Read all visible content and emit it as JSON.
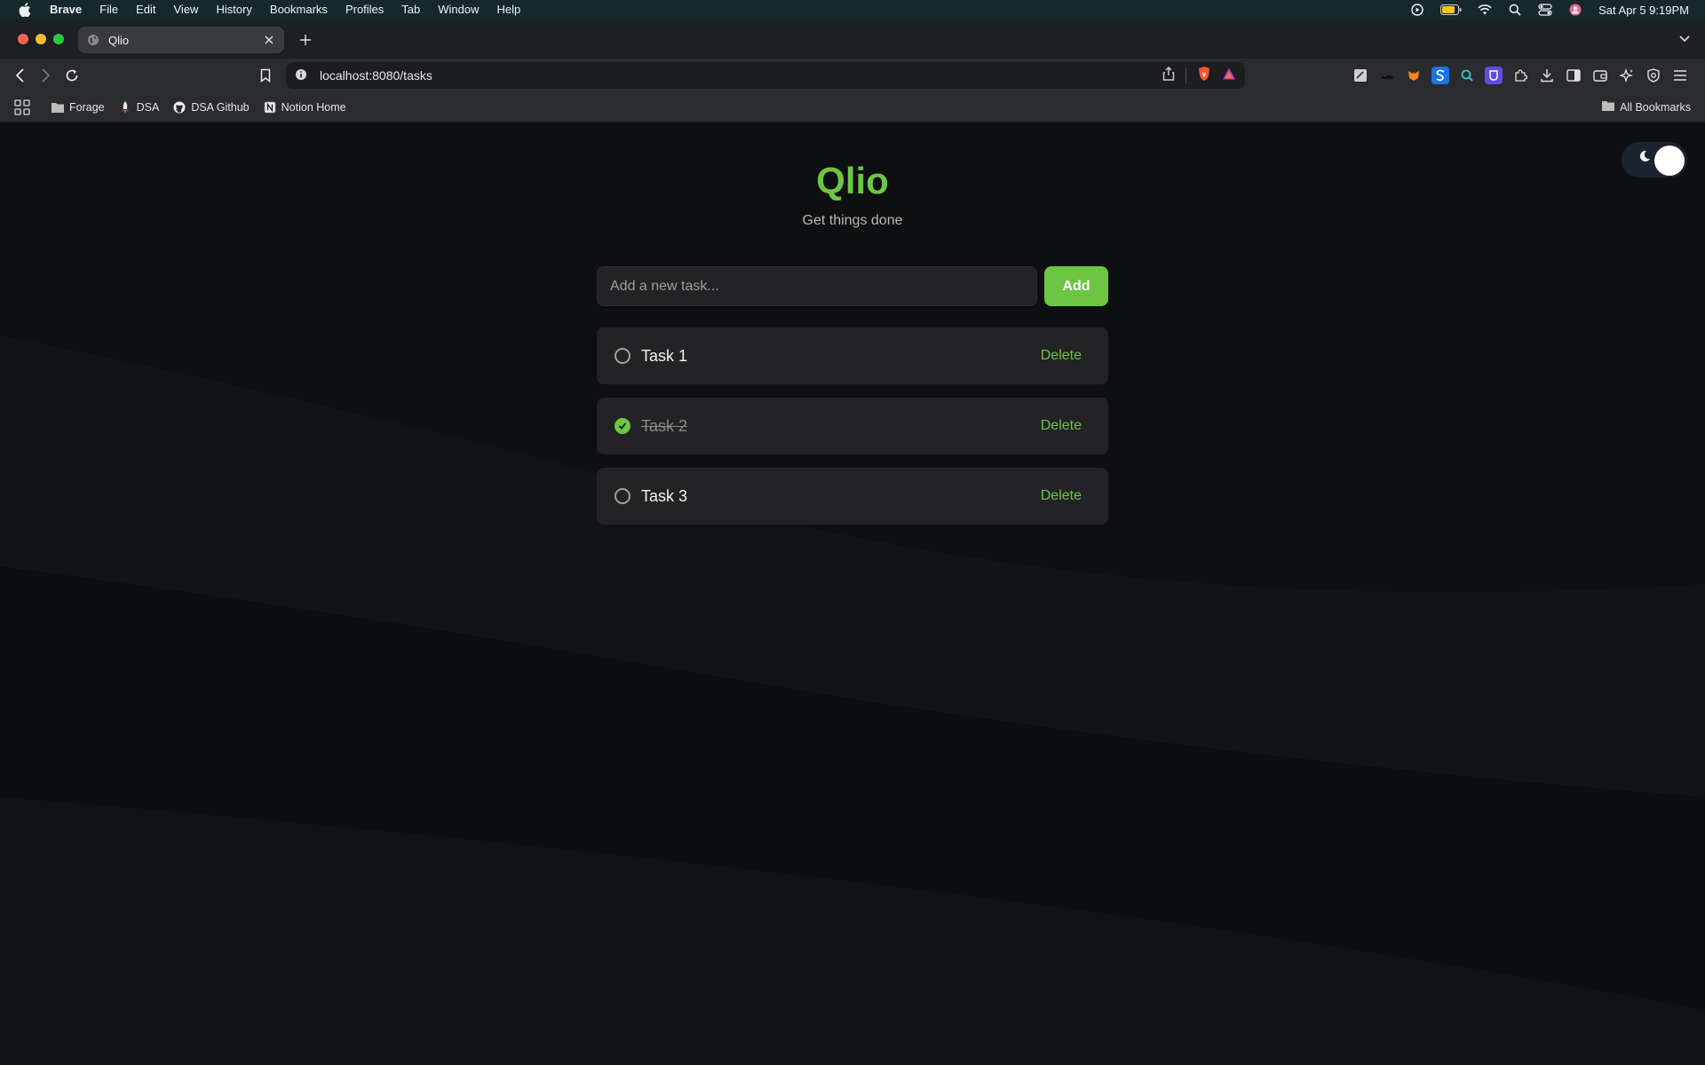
{
  "menubar": {
    "app": "Brave",
    "items": [
      "File",
      "Edit",
      "View",
      "History",
      "Bookmarks",
      "Profiles",
      "Tab",
      "Window",
      "Help"
    ],
    "clock": "Sat Apr 5  9:19PM"
  },
  "browser": {
    "tab_title": "Qlio",
    "url": "localhost:8080/tasks"
  },
  "bookmarks": {
    "items": [
      "Forage",
      "DSA",
      "DSA Github",
      "Notion Home"
    ],
    "all_label": "All Bookmarks"
  },
  "app": {
    "title": "Qlio",
    "subtitle": "Get things done",
    "input_placeholder": "Add a new task...",
    "add_label": "Add",
    "accent_color": "#6cc644",
    "tasks": [
      {
        "label": "Task 1",
        "done": false,
        "delete_label": "Delete"
      },
      {
        "label": "Task 2",
        "done": true,
        "delete_label": "Delete"
      },
      {
        "label": "Task 3",
        "done": false,
        "delete_label": "Delete"
      }
    ]
  }
}
